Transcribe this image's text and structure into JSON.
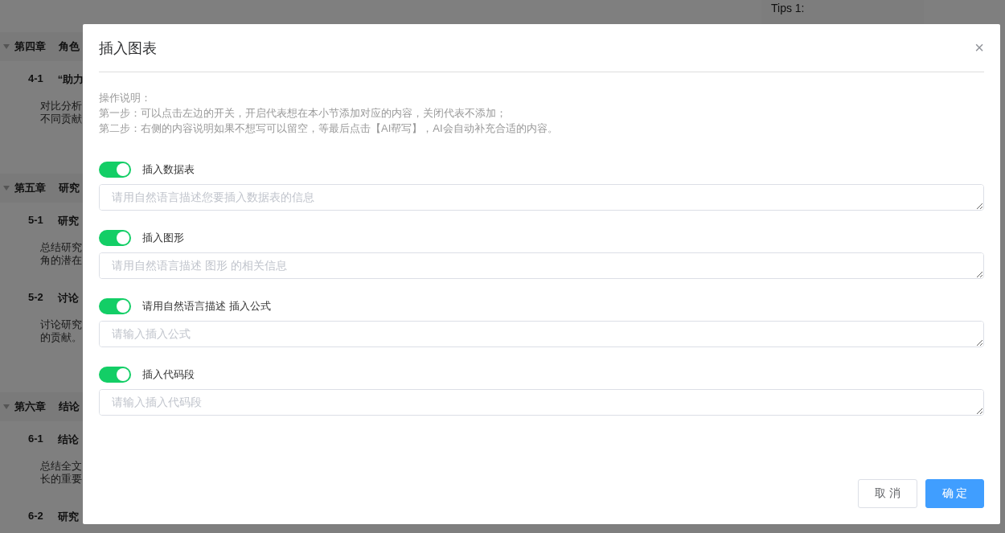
{
  "background": {
    "sections": [
      {
        "chapter_number": "第四章",
        "chapter_title": "角色",
        "items": [
          {
            "number": "4-1",
            "title": "“助力",
            "lines": [
              "对比分析",
              "不同贡献"
            ]
          }
        ]
      },
      {
        "chapter_number": "第五章",
        "chapter_title": "研究",
        "items": [
          {
            "number": "5-1",
            "title": "研究",
            "lines": [
              "总结研究",
              "角的潜在"
            ]
          },
          {
            "number": "5-2",
            "title": "讨论",
            "lines": [
              "讨论研究",
              "的贡献。"
            ]
          }
        ]
      },
      {
        "chapter_number": "第六章",
        "chapter_title": "结论",
        "items": [
          {
            "number": "6-1",
            "title": "结论",
            "lines": [
              "总结全文",
              "长的重要"
            ]
          },
          {
            "number": "6-2",
            "title": "研究"
          }
        ]
      }
    ],
    "tips": {
      "title": "Tips 1:"
    }
  },
  "dialog": {
    "title": "插入图表",
    "close": "×",
    "instructions": [
      "操作说明：",
      "第一步：可以点击左边的开关，开启代表想在本小节添加对应的内容，关闭代表不添加；",
      "第二步：右侧的内容说明如果不想写可以留空，等最后点击【AI帮写】，AI会自动补充合适的内容。"
    ],
    "options": [
      {
        "label": "插入数据表",
        "on": true,
        "placeholder": "请用自然语言描述您要插入数据表的信息"
      },
      {
        "label": "插入图形",
        "on": true,
        "placeholder": "请用自然语言描述 图形 的相关信息"
      },
      {
        "label": "请用自然语言描述 插入公式",
        "on": true,
        "placeholder": "请输入插入公式"
      },
      {
        "label": "插入代码段",
        "on": true,
        "placeholder": "请输入插入代码段"
      }
    ],
    "buttons": [
      {
        "label": "取 消",
        "kind": "secondary"
      },
      {
        "label": "确 定",
        "kind": "primary"
      }
    ]
  }
}
